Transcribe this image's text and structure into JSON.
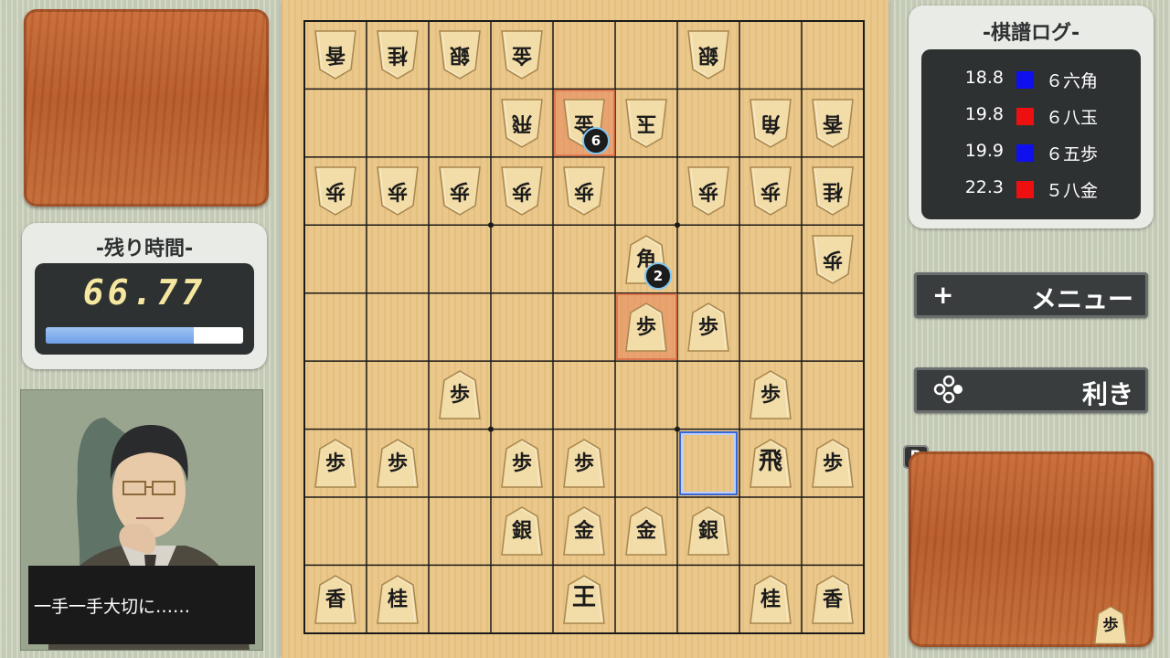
{
  "timer": {
    "title": "-残り時間-",
    "value": "66.77",
    "remaining_fraction": 0.75
  },
  "dialog": {
    "text": "一手一手大切に……"
  },
  "kifu": {
    "title": "-棋譜ログ-",
    "moves": [
      {
        "time": "18.8",
        "color": "#1010ee",
        "move": "６六角"
      },
      {
        "time": "19.8",
        "color": "#ee1010",
        "move": "６八玉"
      },
      {
        "time": "19.9",
        "color": "#1010ee",
        "move": "６五歩"
      },
      {
        "time": "22.3",
        "color": "#ee1010",
        "move": "５八金"
      }
    ]
  },
  "menu": {
    "icon": "+",
    "label": "メニュー"
  },
  "kiki": {
    "icon": "buttons-icon",
    "label": "利き"
  },
  "r_badge": "R",
  "markers": [
    {
      "label": "6"
    },
    {
      "label": "2"
    }
  ],
  "hand": {
    "bottom_piece": "歩"
  },
  "board": {
    "pieces": [
      {
        "row": 1,
        "col": 1,
        "ch": "香",
        "side": "gote"
      },
      {
        "row": 1,
        "col": 2,
        "ch": "桂",
        "side": "gote"
      },
      {
        "row": 1,
        "col": 3,
        "ch": "銀",
        "side": "gote"
      },
      {
        "row": 1,
        "col": 4,
        "ch": "金",
        "side": "gote"
      },
      {
        "row": 1,
        "col": 7,
        "ch": "銀",
        "side": "gote"
      },
      {
        "row": 2,
        "col": 4,
        "ch": "飛",
        "side": "gote"
      },
      {
        "row": 2,
        "col": 5,
        "ch": "金",
        "side": "gote"
      },
      {
        "row": 2,
        "col": 6,
        "ch": "玉",
        "side": "gote"
      },
      {
        "row": 2,
        "col": 8,
        "ch": "角",
        "side": "gote"
      },
      {
        "row": 2,
        "col": 9,
        "ch": "香",
        "side": "gote"
      },
      {
        "row": 3,
        "col": 1,
        "ch": "歩",
        "side": "gote"
      },
      {
        "row": 3,
        "col": 2,
        "ch": "歩",
        "side": "gote"
      },
      {
        "row": 3,
        "col": 3,
        "ch": "歩",
        "side": "gote"
      },
      {
        "row": 3,
        "col": 4,
        "ch": "歩",
        "side": "gote"
      },
      {
        "row": 3,
        "col": 5,
        "ch": "歩",
        "side": "gote"
      },
      {
        "row": 3,
        "col": 7,
        "ch": "歩",
        "side": "gote"
      },
      {
        "row": 3,
        "col": 8,
        "ch": "歩",
        "side": "gote"
      },
      {
        "row": 3,
        "col": 9,
        "ch": "桂",
        "side": "gote"
      },
      {
        "row": 4,
        "col": 9,
        "ch": "歩",
        "side": "gote"
      },
      {
        "row": 4,
        "col": 6,
        "ch": "角",
        "side": "sente"
      },
      {
        "row": 5,
        "col": 6,
        "ch": "歩",
        "side": "sente"
      },
      {
        "row": 5,
        "col": 7,
        "ch": "歩",
        "side": "sente"
      },
      {
        "row": 6,
        "col": 3,
        "ch": "歩",
        "side": "sente"
      },
      {
        "row": 6,
        "col": 8,
        "ch": "歩",
        "side": "sente"
      },
      {
        "row": 7,
        "col": 1,
        "ch": "歩",
        "side": "sente"
      },
      {
        "row": 7,
        "col": 2,
        "ch": "歩",
        "side": "sente"
      },
      {
        "row": 7,
        "col": 4,
        "ch": "歩",
        "side": "sente"
      },
      {
        "row": 7,
        "col": 5,
        "ch": "歩",
        "side": "sente"
      },
      {
        "row": 7,
        "col": 8,
        "ch": "飛",
        "side": "sente"
      },
      {
        "row": 7,
        "col": 9,
        "ch": "歩",
        "side": "sente"
      },
      {
        "row": 8,
        "col": 4,
        "ch": "銀",
        "side": "sente"
      },
      {
        "row": 8,
        "col": 5,
        "ch": "金",
        "side": "sente"
      },
      {
        "row": 8,
        "col": 6,
        "ch": "金",
        "side": "sente"
      },
      {
        "row": 8,
        "col": 7,
        "ch": "銀",
        "side": "sente"
      },
      {
        "row": 9,
        "col": 1,
        "ch": "香",
        "side": "sente"
      },
      {
        "row": 9,
        "col": 2,
        "ch": "桂",
        "side": "sente"
      },
      {
        "row": 9,
        "col": 5,
        "ch": "王",
        "side": "sente"
      },
      {
        "row": 9,
        "col": 8,
        "ch": "桂",
        "side": "sente"
      },
      {
        "row": 9,
        "col": 9,
        "ch": "香",
        "side": "sente"
      }
    ]
  }
}
